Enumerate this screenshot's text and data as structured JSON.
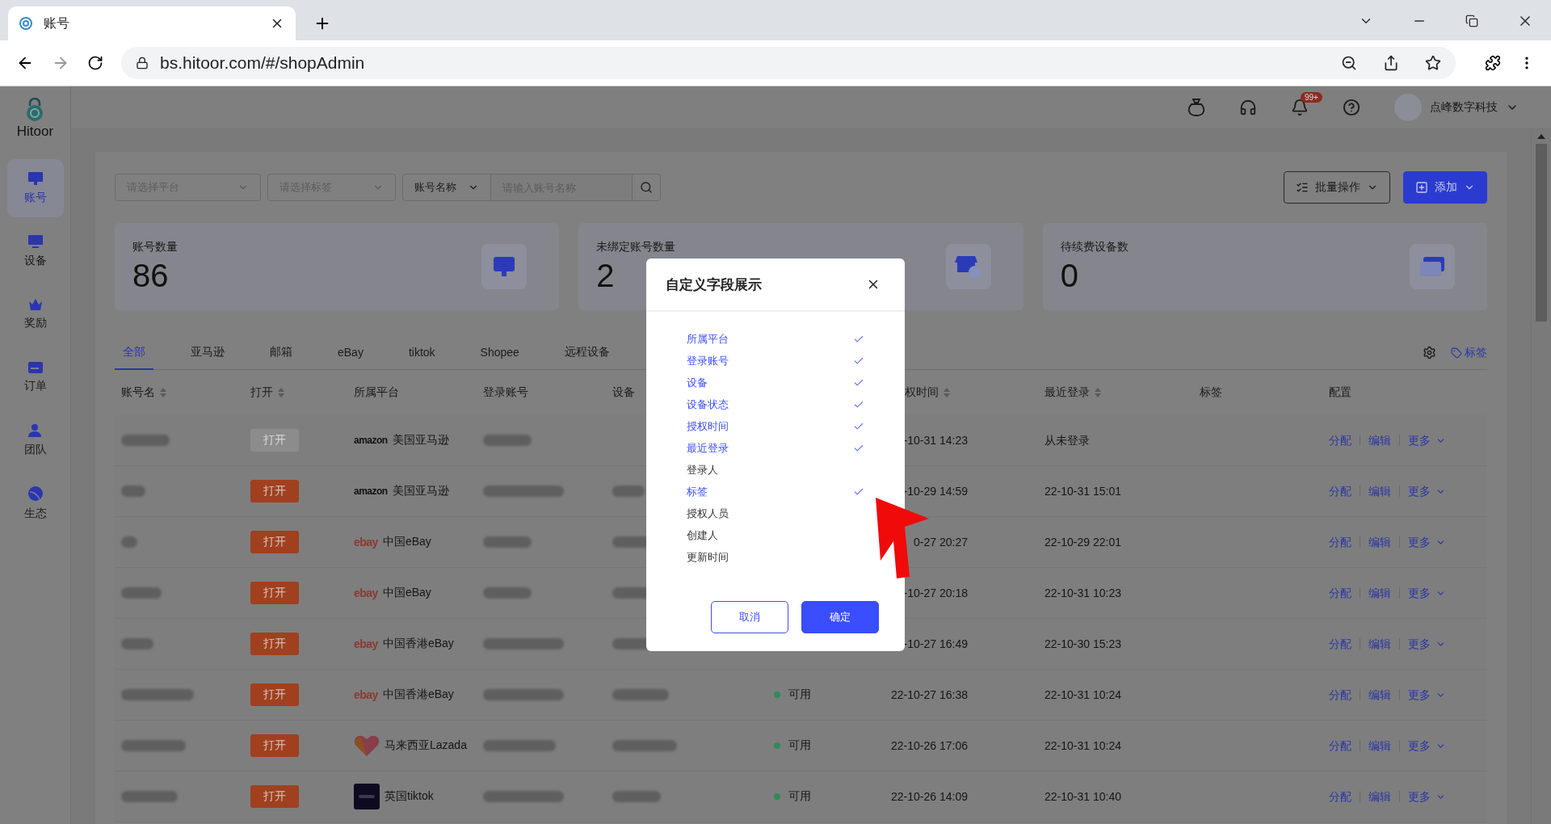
{
  "browser": {
    "tab_title": "账号",
    "url": "bs.hitoor.com/#/shopAdmin"
  },
  "sidebar": {
    "logo_text": "Hitoor",
    "items": [
      {
        "label": "账号",
        "selected": true
      },
      {
        "label": "设备",
        "selected": false
      },
      {
        "label": "奖励",
        "selected": false
      },
      {
        "label": "订单",
        "selected": false
      },
      {
        "label": "团队",
        "selected": false
      },
      {
        "label": "生态",
        "selected": false
      }
    ]
  },
  "header": {
    "notification_badge": "99+",
    "company": "点峰数字科技"
  },
  "filters": {
    "platform_placeholder": "请选择平台",
    "tag_placeholder": "请选择标签",
    "search_type": "账号名称",
    "search_placeholder": "请输入账号名称"
  },
  "actions": [
    "批量操作",
    "添加"
  ],
  "stats": [
    {
      "label": "账号数量",
      "value": "86",
      "kind": "accounts"
    },
    {
      "label": "未绑定账号数量",
      "value": "2",
      "kind": "unbound"
    },
    {
      "label": "待续费设备数",
      "value": "0",
      "kind": "renewal"
    }
  ],
  "tabs": [
    {
      "label": "全部",
      "selected": true
    },
    {
      "label": "亚马逊",
      "selected": false
    },
    {
      "label": "邮箱",
      "selected": false
    },
    {
      "label": "eBay",
      "selected": false
    },
    {
      "label": "tiktok",
      "selected": false
    },
    {
      "label": "Shopee",
      "selected": false
    },
    {
      "label": "远程设备",
      "selected": false
    }
  ],
  "tag_link": "标签",
  "table": {
    "columns": [
      {
        "label": "账号名",
        "sortable": true
      },
      {
        "label": "打开",
        "sortable": true
      },
      {
        "label": "所属平台",
        "sortable": false
      },
      {
        "label": "登录账号",
        "sortable": false
      },
      {
        "label": "设备",
        "sortable": false
      },
      {
        "label": "权时间",
        "sortable": true
      },
      {
        "label": "最近登录",
        "sortable": true
      },
      {
        "label": "标签",
        "sortable": false
      },
      {
        "label": "配置",
        "sortable": false
      }
    ],
    "rows": [
      {
        "open": "打开",
        "open_disabled": true,
        "kind": "amazon",
        "logo_text": "amazon",
        "platform": "美国亚马逊",
        "auth_time": "-10-31 14:23",
        "last_login": "从未登录",
        "actions": [
          "分配",
          "编辑",
          "更多"
        ]
      },
      {
        "open": "打开",
        "open_disabled": false,
        "kind": "amazon",
        "logo_text": "amazon",
        "platform": "美国亚马逊",
        "auth_time": "-10-29 14:59",
        "last_login": "22-10-31 15:01",
        "actions": [
          "分配",
          "编辑",
          "更多"
        ]
      },
      {
        "open": "打开",
        "open_disabled": false,
        "kind": "ebay",
        "logo_text": "ebay",
        "platform": "中国eBay",
        "auth_time": "0-27 20:27",
        "last_login": "22-10-29 22:01",
        "actions": [
          "分配",
          "编辑",
          "更多"
        ]
      },
      {
        "open": "打开",
        "open_disabled": false,
        "kind": "ebay",
        "logo_text": "ebay",
        "platform": "中国eBay",
        "auth_time": "-10-27 20:18",
        "last_login": "22-10-31 10:23",
        "actions": [
          "分配",
          "编辑",
          "更多"
        ]
      },
      {
        "open": "打开",
        "open_disabled": false,
        "kind": "ebay",
        "logo_text": "ebay",
        "platform": "中国香港eBay",
        "auth_time": "-10-27 16:49",
        "last_login": "22-10-30 15:23",
        "actions": [
          "分配",
          "编辑",
          "更多"
        ]
      },
      {
        "open": "打开",
        "open_disabled": false,
        "kind": "ebay",
        "logo_text": "ebay",
        "platform": "中国香港eBay",
        "status": "可用",
        "color": "#2e8b57",
        "auth_time": "22-10-27 16:38",
        "last_login": "22-10-31 10:24",
        "actions": [
          "分配",
          "编辑",
          "更多"
        ]
      },
      {
        "open": "打开",
        "open_disabled": false,
        "kind": "lazada",
        "platform": "马来西亚Lazada",
        "status": "可用",
        "color": "#2e8b57",
        "auth_time": "22-10-26 17:06",
        "last_login": "22-10-31 10:24",
        "actions": [
          "分配",
          "编辑",
          "更多"
        ]
      },
      {
        "open": "打开",
        "open_disabled": false,
        "kind": "tiktok",
        "platform": "英国tiktok",
        "status": "可用",
        "color": "#2e8b57",
        "auth_time": "22-10-26 14:09",
        "last_login": "22-10-31 10:40",
        "actions": [
          "分配",
          "编辑",
          "更多"
        ]
      }
    ]
  },
  "dialog": {
    "title": "自定义字段展示",
    "fields": [
      {
        "label": "所属平台",
        "checked": true
      },
      {
        "label": "登录账号",
        "checked": true
      },
      {
        "label": "设备",
        "checked": true
      },
      {
        "label": "设备状态",
        "checked": true
      },
      {
        "label": "授权时间",
        "checked": true
      },
      {
        "label": "最近登录",
        "checked": true
      },
      {
        "label": "登录人",
        "checked": false
      },
      {
        "label": "标签",
        "checked": true
      },
      {
        "label": "授权人员",
        "checked": false
      },
      {
        "label": "创建人",
        "checked": false
      },
      {
        "label": "更新时间",
        "checked": false
      }
    ],
    "cancel": "取消",
    "confirm": "确定"
  }
}
